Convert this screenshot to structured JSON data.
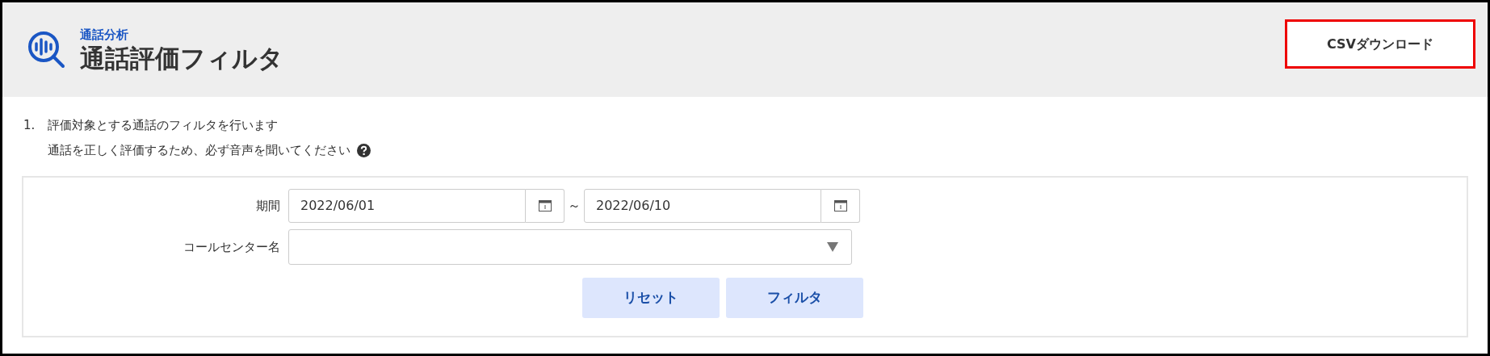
{
  "header": {
    "section": "通話分析",
    "title": "通話評価フィルタ",
    "download_button": "CSVダウンロード"
  },
  "instruction": {
    "number": "1.",
    "lines": [
      "評価対象とする通話のフィルタを行います",
      "通話を正しく評価するため、必ず音声を聞いてください"
    ]
  },
  "form": {
    "period": {
      "label": "期間",
      "start": "2022/06/01",
      "separator": "～",
      "end": "2022/06/10"
    },
    "call_center": {
      "label": "コールセンター名"
    },
    "buttons": [
      "リセット",
      "フィルタ"
    ]
  }
}
